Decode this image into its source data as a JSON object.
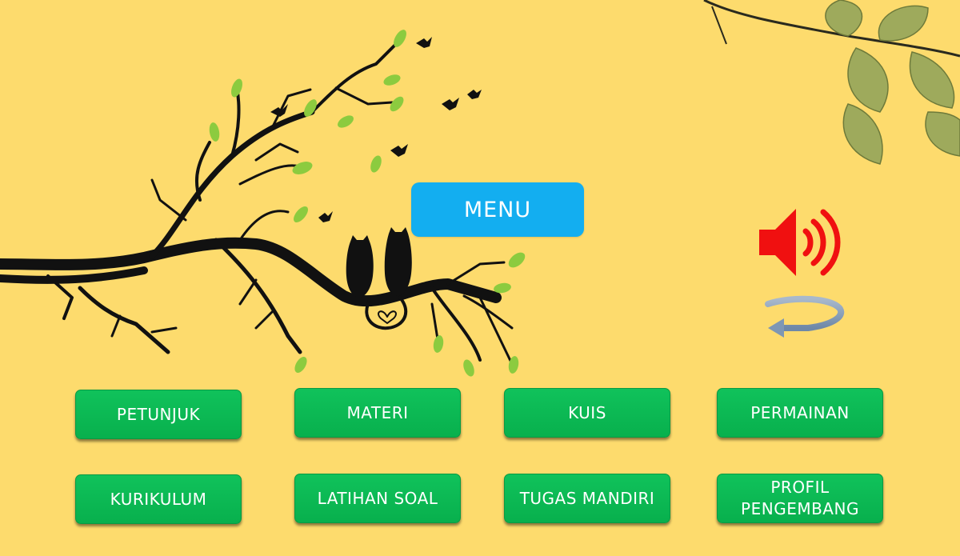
{
  "menu": {
    "title": "MENU"
  },
  "buttons": [
    {
      "label": "PETUNJUK"
    },
    {
      "label": "MATERI"
    },
    {
      "label": "KUIS"
    },
    {
      "label": "PERMAINAN"
    },
    {
      "label": "KURIKULUM"
    },
    {
      "label": "LATIHAN SOAL"
    },
    {
      "label": "TUGAS MANDIRI"
    },
    {
      "label": "PROFIL\nPENGEMBANG"
    }
  ],
  "icons": {
    "sound": "speaker-icon",
    "back": "back-arrow-icon"
  },
  "colors": {
    "background": "#FDDB6D",
    "menu": "#13AEF0",
    "button": "#0CB955",
    "speaker": "#F01010",
    "back_arrow": "#7E97B4"
  }
}
